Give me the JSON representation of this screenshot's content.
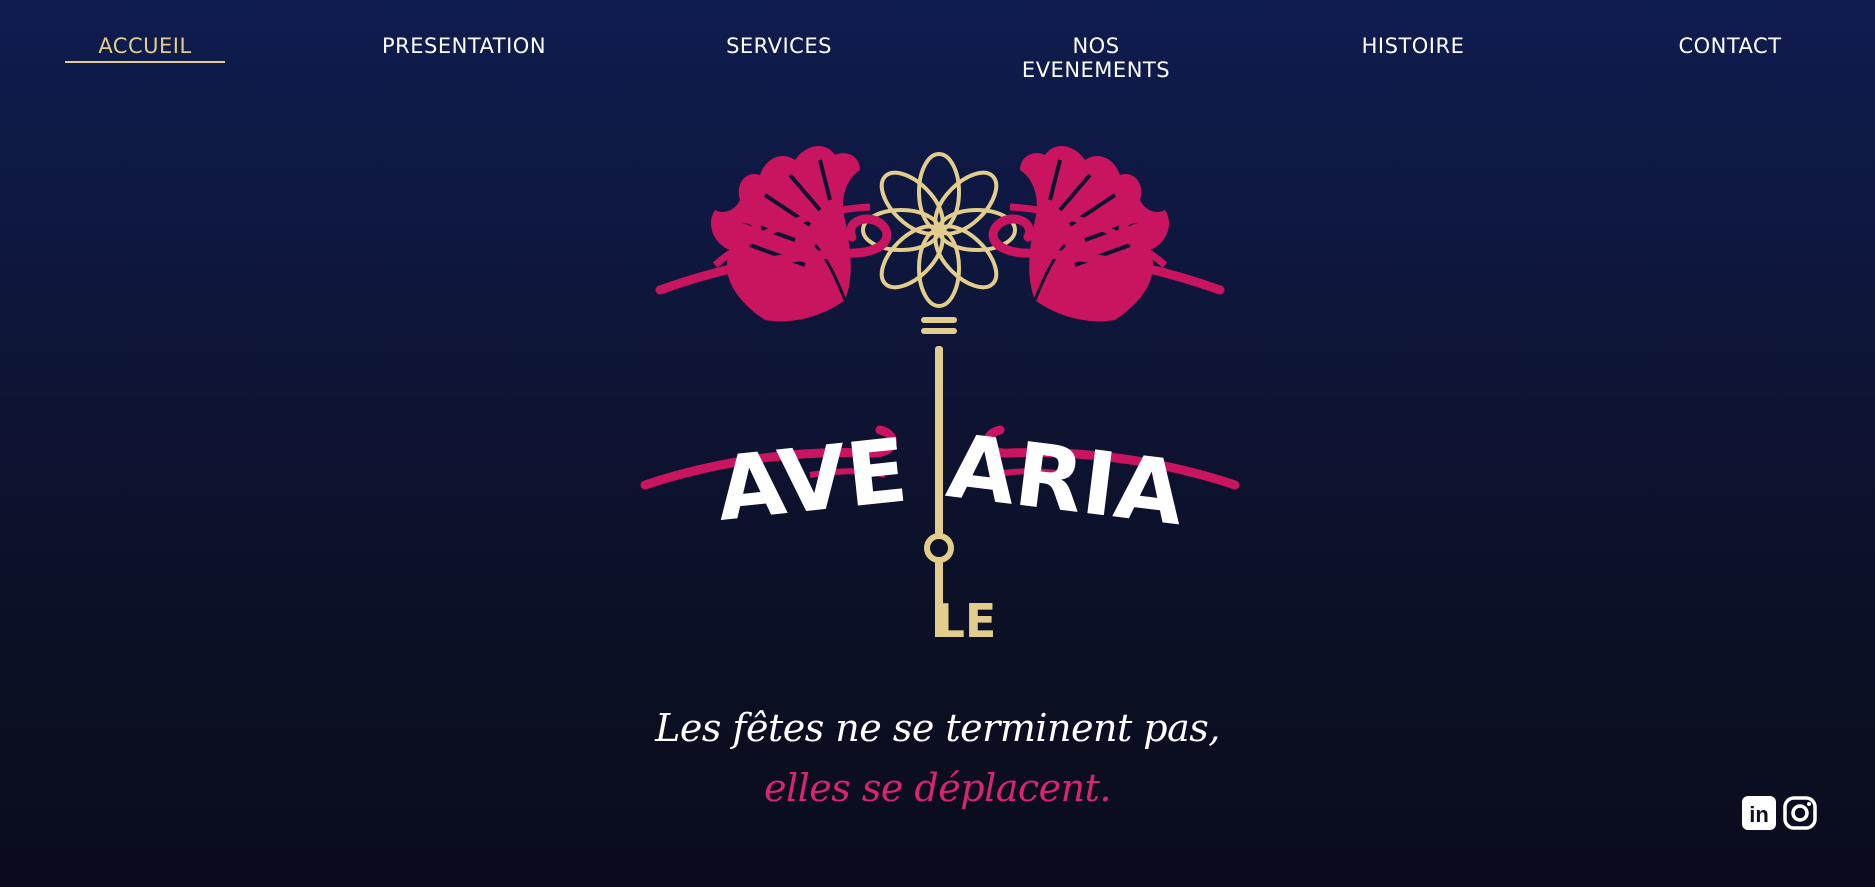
{
  "nav": {
    "items": [
      {
        "label": "ACCUEIL",
        "active": true
      },
      {
        "label": "PRESENTATION",
        "active": false
      },
      {
        "label": "SERVICES",
        "active": false
      },
      {
        "label": "NOS EVENEMENTS",
        "active": false
      },
      {
        "label": "HISTOIRE",
        "active": false
      },
      {
        "label": "CONTACT",
        "active": false
      }
    ]
  },
  "logo": {
    "word_left": "AVE",
    "word_right": "ARIA",
    "monogram": "LE"
  },
  "tagline": {
    "line1": "Les fêtes ne se terminent pas,",
    "line2": "elles se déplacent."
  },
  "social": {
    "icons": [
      "linkedin-icon",
      "instagram-icon"
    ],
    "linkedin_glyph": "in"
  },
  "colors": {
    "accent_gold": "#e2cd8c",
    "accent_pink": "#d9246f",
    "background_top": "#0f1c4e",
    "background_bottom": "#0a0c1d"
  }
}
